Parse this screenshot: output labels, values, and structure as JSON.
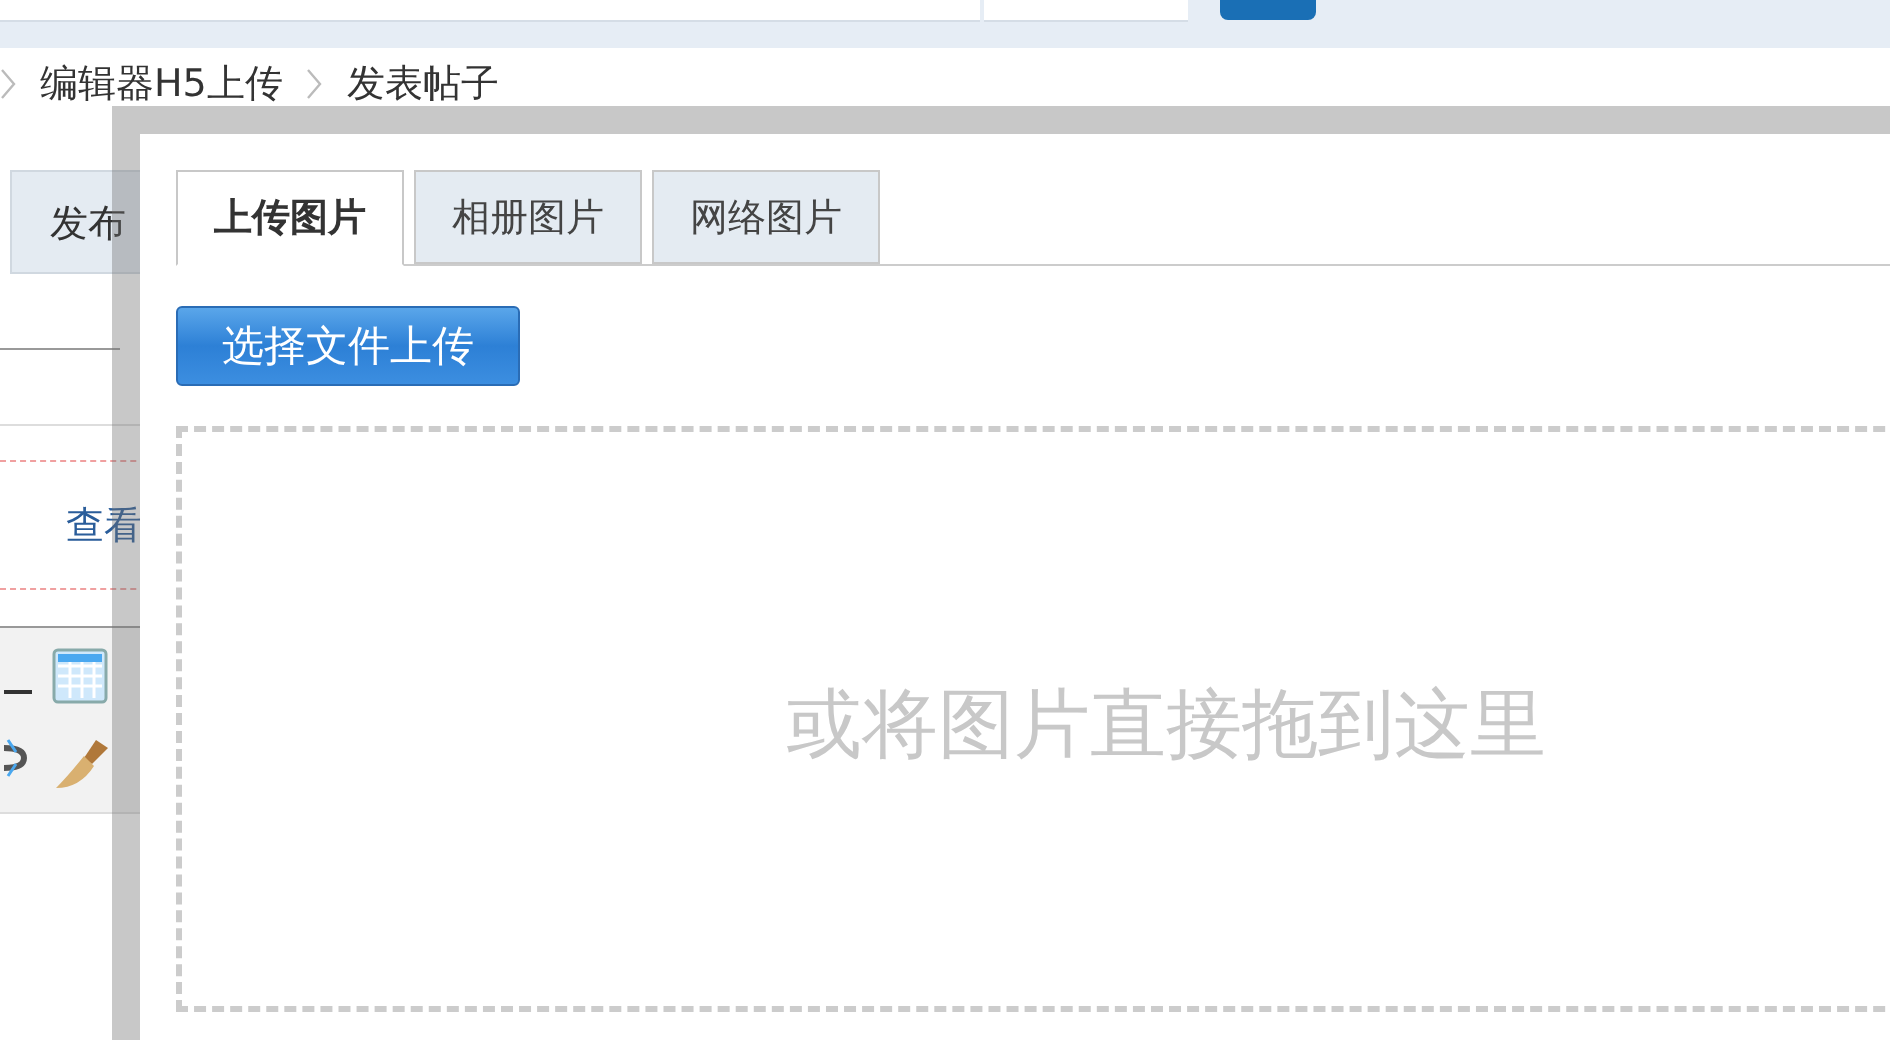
{
  "breadcrumb": [
    "编辑器H5上传",
    "发表帖子"
  ],
  "page_tab": {
    "label": "发布"
  },
  "view_link": "查看",
  "dialog": {
    "tabs": [
      {
        "label": "上传图片",
        "selected": true
      },
      {
        "label": "相册图片",
        "selected": false
      },
      {
        "label": "网络图片",
        "selected": false
      }
    ],
    "upload_button": "选择文件上传",
    "drop_hint": "或将图片直接拖到这里"
  }
}
